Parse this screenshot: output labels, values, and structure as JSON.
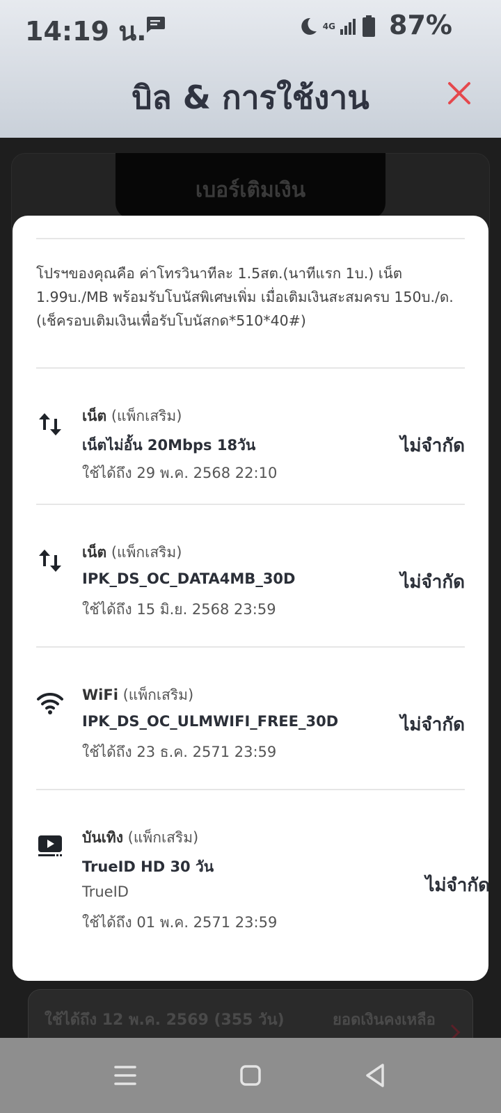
{
  "status_bar": {
    "time": "14:19 น.",
    "network": "4G",
    "battery": "87%"
  },
  "header": {
    "title": "บิล & การใช้งาน"
  },
  "background": {
    "tab_label": "เบอร์เติมเงิน",
    "expiry_text": "ใช้ได้ถึง 12 พ.ค. 2569 (355 วัน)",
    "balance_label": "ยอดเงินคงเหลือ"
  },
  "sheet": {
    "promo_text": "โปรฯของคุณคือ ค่าโทรวินาทีละ 1.5สต.(นาทีแรก 1บ.) เน็ต 1.99บ./MB พร้อมรับโบนัสพิเศษเพิ่ม เมื่อเติมเงินสะสมครบ 150บ./ด. (เช็ครอบเติมเงินเพื่อรับโบนัสกด*510*40#)",
    "packages": [
      {
        "icon": "data-arrows-icon",
        "category": "เน็ต",
        "tag": "(แพ็กเสริม)",
        "name": "เน็ตไม่อั้น 20Mbps 18วัน",
        "expiry": "ใช้ได้ถึง 29 พ.ค. 2568 22:10",
        "quota": "ไม่จำกัด"
      },
      {
        "icon": "data-arrows-icon",
        "category": "เน็ต",
        "tag": "(แพ็กเสริม)",
        "name": "IPK_DS_OC_DATA4MB_30D",
        "expiry": "ใช้ได้ถึง 15 มิ.ย. 2568 23:59",
        "quota": "ไม่จำกัด"
      },
      {
        "icon": "wifi-icon",
        "category": "WiFi",
        "tag": "(แพ็กเสริม)",
        "name": "IPK_DS_OC_ULMWIFI_FREE_30D",
        "expiry": "ใช้ได้ถึง 23 ธ.ค. 2571 23:59",
        "quota": "ไม่จำกัด"
      },
      {
        "icon": "entertainment-play-icon",
        "category": "บันเทิง",
        "tag": "(แพ็กเสริม)",
        "name": "TrueID HD 30 วัน",
        "provider": "TrueID",
        "expiry": "ใช้ได้ถึง 01 พ.ค. 2571 23:59",
        "quota": "ไม่จำกัด"
      }
    ]
  },
  "colors": {
    "accent_close": "#e5484d",
    "header_gradient_top": "#e7eaef",
    "header_gradient_bottom": "#c9d0d9",
    "navbar": "#8e8e8e"
  }
}
